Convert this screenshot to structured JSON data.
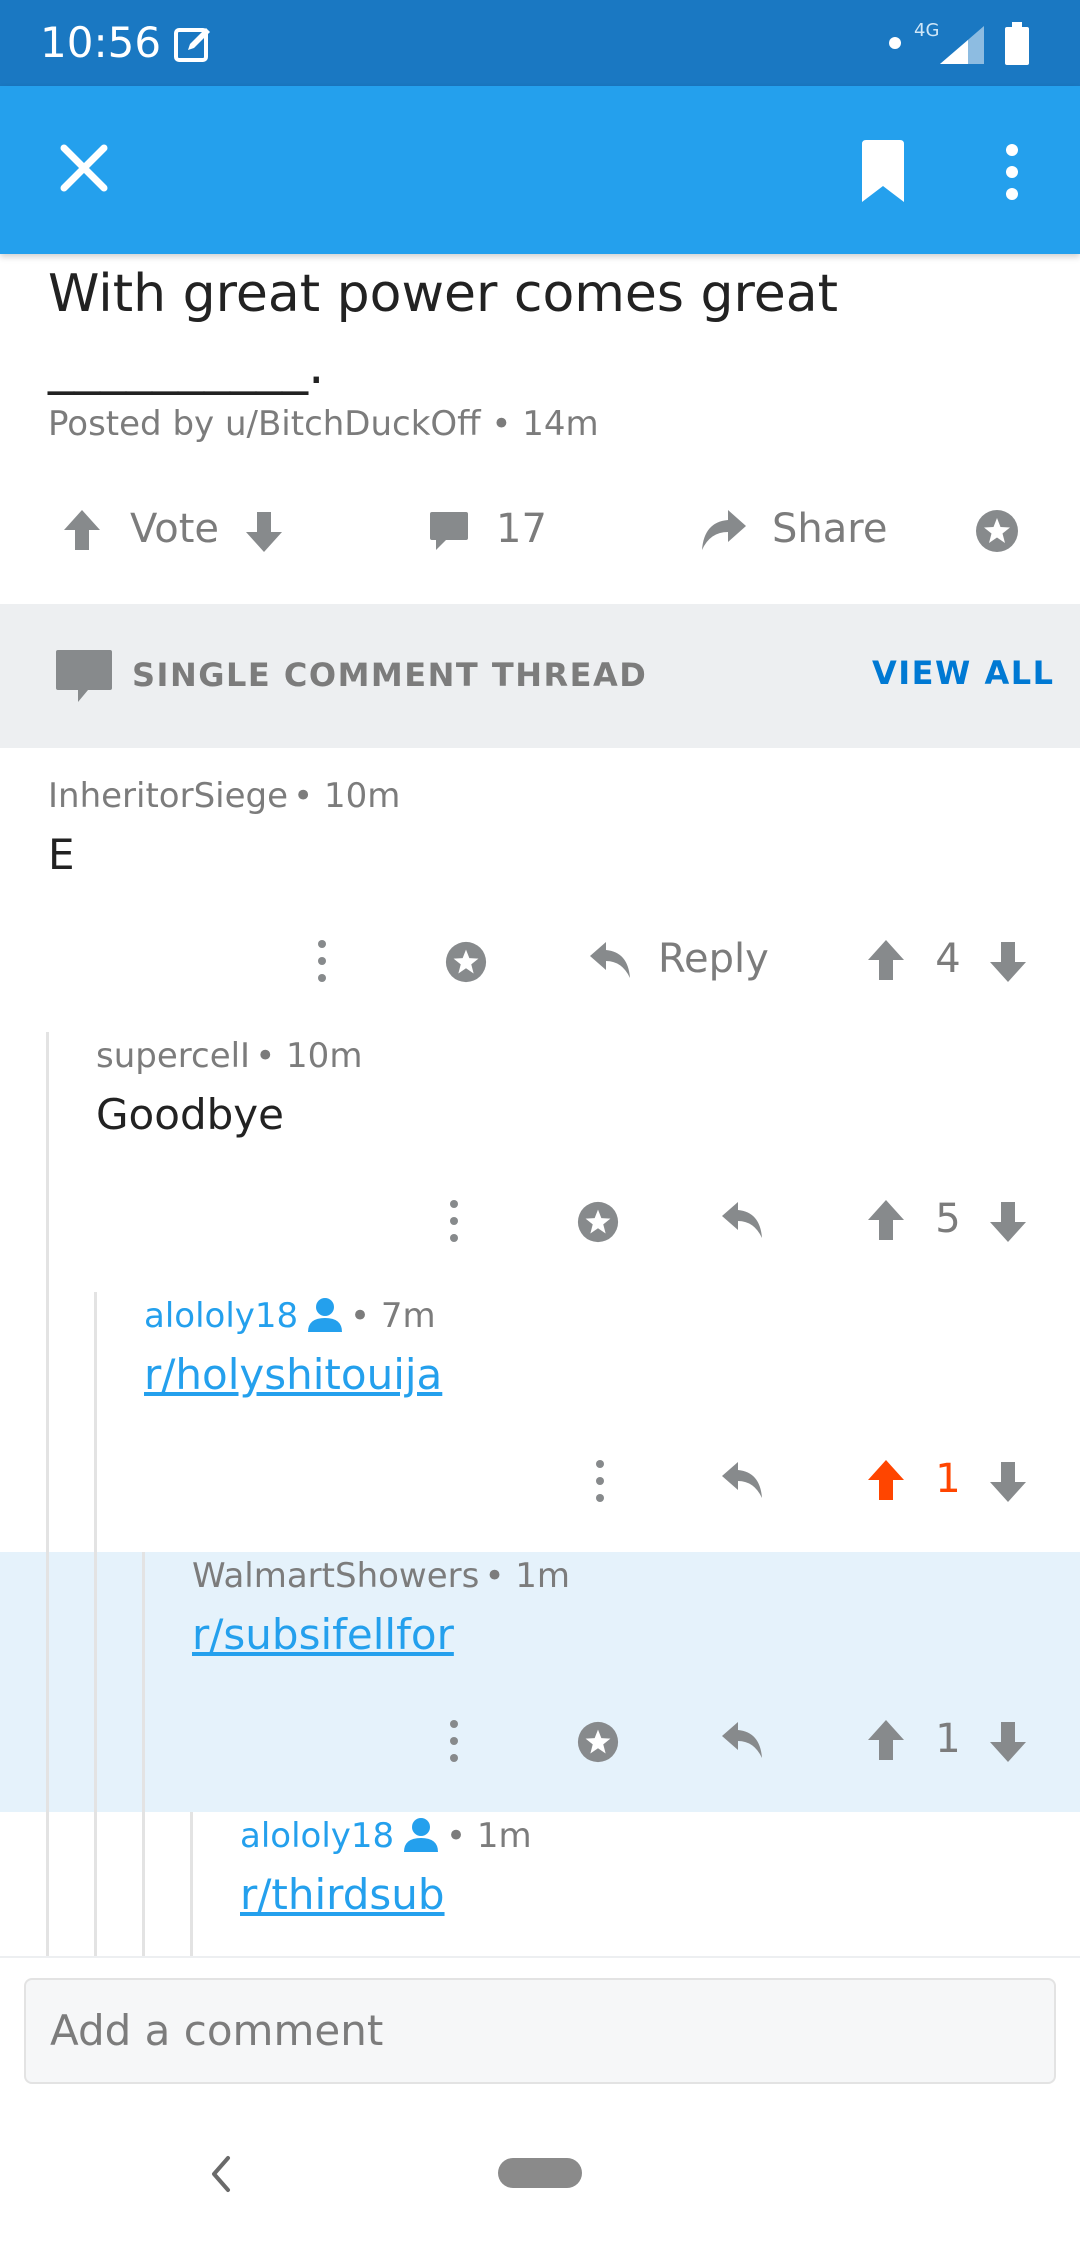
{
  "status_bar": {
    "time": "10:56",
    "network": "4G"
  },
  "app_bar": {
    "close_label": "Close",
    "save_label": "Save",
    "more_label": "More options"
  },
  "post": {
    "title": "With great power comes great __________.",
    "author": "Posted by u/BitchDuckOff",
    "age": "• 14m",
    "vote_label": "Vote",
    "comment_count": "17",
    "share_label": "Share"
  },
  "thread_bar": {
    "label": "SINGLE COMMENT THREAD",
    "view_all": "VIEW ALL"
  },
  "comments": [
    {
      "author": "InheritorSiege",
      "age": "• 10m",
      "body": "E",
      "reply_label": "Reply",
      "votes": "4",
      "vote_state": "none"
    },
    {
      "author": "supercelI",
      "age": "• 10m",
      "body": "Goodbye",
      "votes": "5",
      "vote_state": "none"
    },
    {
      "author": "alololy18",
      "age": "• 7m",
      "body": "r/holyshitouija",
      "votes": "1",
      "vote_state": "upvoted",
      "is_op": true
    },
    {
      "author": "WalmartShowers",
      "age": "• 1m",
      "body": "r/subsifellfor",
      "votes": "1",
      "vote_state": "none",
      "highlighted": true
    },
    {
      "author": "alololy18",
      "age": "• 1m",
      "body": "r/thirdsub",
      "is_op": true
    }
  ],
  "composer": {
    "placeholder": "Add a comment"
  },
  "colors": {
    "brand_blue": "#24a0ed",
    "status_blue": "#1a78c2",
    "upvote_orange": "#ff4500",
    "link_blue": "#0079d3",
    "highlight": "#e5f2fb"
  },
  "icons": [
    "close-icon",
    "bookmark-icon",
    "more-vertical-icon",
    "upvote-icon",
    "downvote-icon",
    "comment-icon",
    "share-icon",
    "award-icon",
    "reply-icon",
    "user-icon",
    "back-icon"
  ]
}
